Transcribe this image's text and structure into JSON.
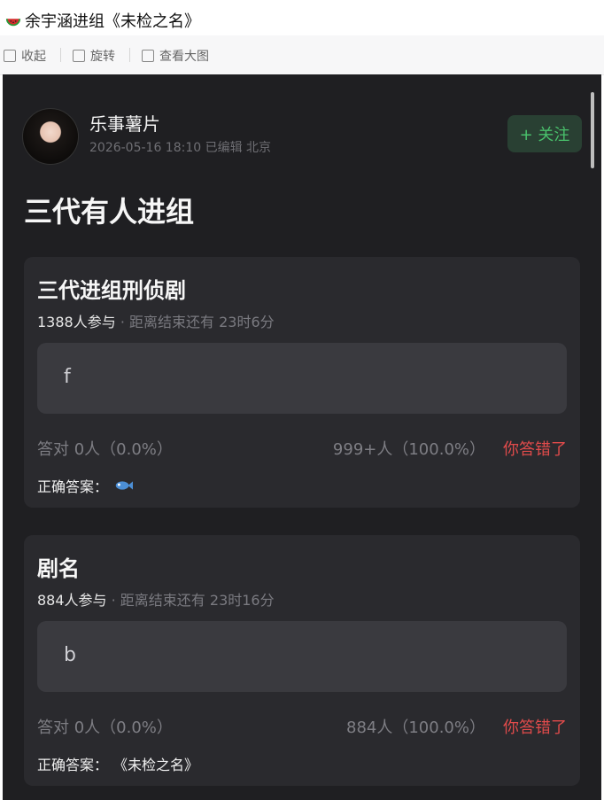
{
  "window": {
    "title": "余宇涵进组《未检之名》",
    "title_icon": "watermelon-icon"
  },
  "toolbar": {
    "collapse": "收起",
    "rotate": "旋转",
    "view_large": "查看大图"
  },
  "post": {
    "author": "乐事薯片",
    "meta": "2026-05-16 18:10  已编辑  北京",
    "follow_label": "+ 关注",
    "title": "三代有人进组"
  },
  "polls": [
    {
      "question": "三代进组刑侦剧",
      "participants": "1388人参与",
      "time_left": " · 距离结束还有 23时6分",
      "answer": "f",
      "stat_correct": "答对  0人（0.0%）",
      "stat_wrong": "999+人（100.0%）",
      "wrong_label": "你答错了",
      "correct_label": "正确答案：",
      "correct_value": "",
      "correct_icon": "fish-icon"
    },
    {
      "question": "剧名",
      "participants": "884人参与",
      "time_left": " · 距离结束还有 23时16分",
      "answer": "b",
      "stat_correct": "答对  0人（0.0%）",
      "stat_wrong": "884人（100.0%）",
      "wrong_label": "你答错了",
      "correct_label": "正确答案：",
      "correct_value": "《未检之名》"
    }
  ],
  "colors": {
    "background": "#1f1f22",
    "card": "#2a2a2e",
    "follow_text": "#49c06b",
    "wrong": "#e14b4b"
  }
}
